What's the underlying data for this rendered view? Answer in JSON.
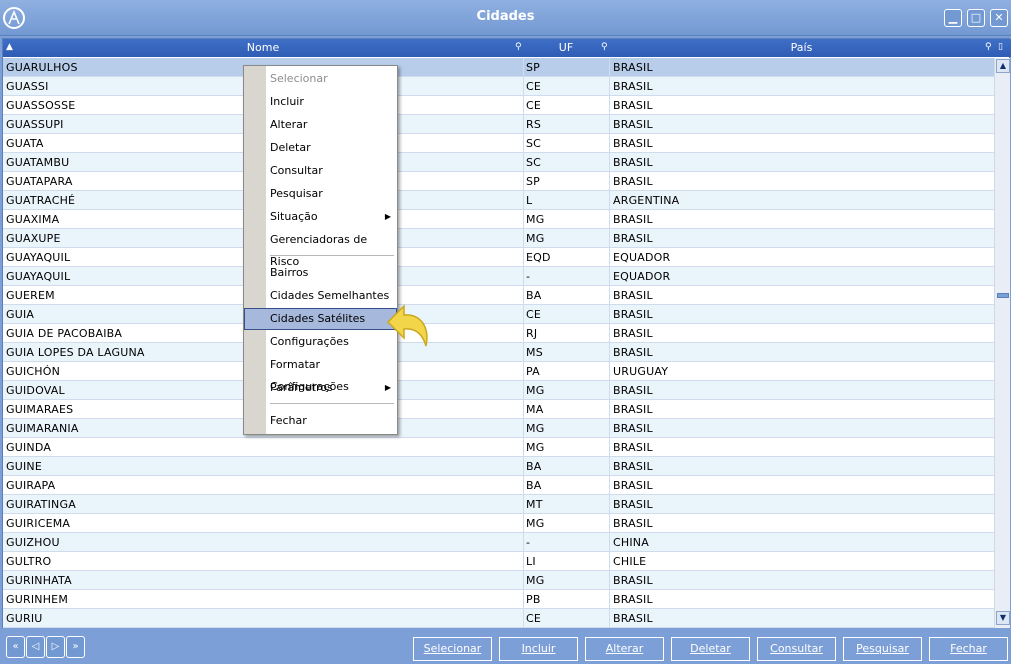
{
  "window": {
    "title": "Cidades"
  },
  "columns": {
    "name": "Nome",
    "uf": "UF",
    "country": "País"
  },
  "rows": [
    [
      "GUARULHOS",
      "SP",
      "BRASIL"
    ],
    [
      "GUASSI",
      "CE",
      "BRASIL"
    ],
    [
      "GUASSOSSE",
      "CE",
      "BRASIL"
    ],
    [
      "GUASSUPI",
      "RS",
      "BRASIL"
    ],
    [
      "GUATA",
      "SC",
      "BRASIL"
    ],
    [
      "GUATAMBU",
      "SC",
      "BRASIL"
    ],
    [
      "GUATAPARA",
      "SP",
      "BRASIL"
    ],
    [
      "GUATRACHÉ",
      "L",
      "ARGENTINA"
    ],
    [
      "GUAXIMA",
      "MG",
      "BRASIL"
    ],
    [
      "GUAXUPE",
      "MG",
      "BRASIL"
    ],
    [
      "GUAYAQUIL",
      "EQD",
      "EQUADOR"
    ],
    [
      "GUAYAQUIL",
      "-",
      "EQUADOR"
    ],
    [
      "GUEREM",
      "BA",
      "BRASIL"
    ],
    [
      "GUIA",
      "CE",
      "BRASIL"
    ],
    [
      "GUIA DE PACOBAIBA",
      "RJ",
      "BRASIL"
    ],
    [
      "GUIA LOPES DA LAGUNA",
      "MS",
      "BRASIL"
    ],
    [
      "GUICHÓN",
      "PA",
      "URUGUAY"
    ],
    [
      "GUIDOVAL",
      "MG",
      "BRASIL"
    ],
    [
      "GUIMARAES",
      "MA",
      "BRASIL"
    ],
    [
      "GUIMARANIA",
      "MG",
      "BRASIL"
    ],
    [
      "GUINDA",
      "MG",
      "BRASIL"
    ],
    [
      "GUINE",
      "BA",
      "BRASIL"
    ],
    [
      "GUIRAPA",
      "BA",
      "BRASIL"
    ],
    [
      "GUIRATINGA",
      "MT",
      "BRASIL"
    ],
    [
      "GUIRICEMA",
      "MG",
      "BRASIL"
    ],
    [
      "GUIZHOU",
      "-",
      "CHINA"
    ],
    [
      "GULTRO",
      "LI",
      "CHILE"
    ],
    [
      "GURINHATA",
      "MG",
      "BRASIL"
    ],
    [
      "GURINHEM",
      "PB",
      "BRASIL"
    ],
    [
      "GURIU",
      "CE",
      "BRASIL"
    ]
  ],
  "context_menu": {
    "items": [
      {
        "label": "Selecionar",
        "disabled": true
      },
      {
        "label": "Incluir"
      },
      {
        "label": "Alterar"
      },
      {
        "label": "Deletar"
      },
      {
        "label": "Consultar"
      },
      {
        "label": "Pesquisar"
      },
      {
        "label": "Situação",
        "submenu": true
      },
      {
        "label": "Gerenciadoras de Risco"
      },
      {
        "label": "Bairros"
      },
      {
        "label": "Cidades Semelhantes"
      },
      {
        "label": "Cidades Satélites",
        "highlighted": true
      },
      {
        "label": "Configurações"
      },
      {
        "label": "Formatar Configurações"
      },
      {
        "label": "Parâmetros",
        "submenu": true
      },
      {
        "label": "Fechar"
      }
    ]
  },
  "toolbar": {
    "select": "Selecionar",
    "include": "Incluir",
    "alter": "Alterar",
    "delete": "Deletar",
    "consult": "Consultar",
    "search": "Pesquisar",
    "close": "Fechar"
  },
  "icons": {
    "nav_first": "first-page-icon",
    "nav_prev": "previous-page-icon",
    "nav_next": "next-page-icon",
    "nav_last": "last-page-icon"
  },
  "colors": {
    "accent": "#2f5cb4",
    "row_alt": "#eaf4fb",
    "row_selected": "#b7cdea",
    "frame": "#7b9fd6"
  }
}
